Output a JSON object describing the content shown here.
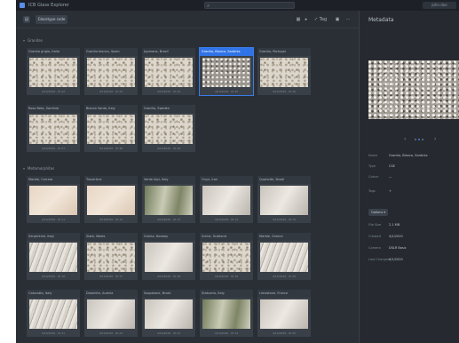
{
  "titlebar": {
    "app_title": "ICB Glass Explorer",
    "user": "john.doe"
  },
  "toolbar": {
    "pill": "Glasstype code",
    "grid_icon": "grid-icon",
    "arrow": "▸",
    "tag_label": "✓ Tag",
    "more": "⋯"
  },
  "sections": {
    "groups_title": "Granites",
    "minerals_title": "Metamorphites"
  },
  "groups_cards": [
    {
      "title": "Granito grigio, Italia",
      "foot": "4/10/2020 · ID 42"
    },
    {
      "title": "Granito bianco, Spain",
      "foot": "4/10/2020 · ID 43"
    },
    {
      "title": "Juparana, Brazil",
      "foot": "4/10/2020 · ID 44"
    },
    {
      "title": "Granito, Bianco, Sardinia",
      "foot": "4/10/2020 · ID 45"
    },
    {
      "title": "Granito, Portugal",
      "foot": "4/10/2020 · ID 46"
    },
    {
      "title": "Rosa Beta, Sardinia",
      "foot": "4/10/2020 · ID 47"
    },
    {
      "title": "Bianco Sardo, Italy",
      "foot": "4/10/2020 · ID 48"
    },
    {
      "title": "Granito, Sweden",
      "foot": "4/10/2020 · ID 49"
    }
  ],
  "minerals_cards": [
    {
      "title": "Marble, Carrara",
      "foot": "4/10/2020 · ID 11"
    },
    {
      "title": "Travertine",
      "foot": "4/10/2020 · ID 12"
    },
    {
      "title": "Verde Alpi, Italy",
      "foot": "4/10/2020 · ID 13"
    },
    {
      "title": "Onyx, Iran",
      "foot": "4/10/2020 · ID 14"
    },
    {
      "title": "Quartzite, Brazil",
      "foot": "4/10/2020 · ID 15"
    },
    {
      "title": "Serpentine, Italy",
      "foot": "4/10/2020 · ID 16"
    },
    {
      "title": "Slate, Wales",
      "foot": "4/10/2020 · ID 17"
    },
    {
      "title": "Gneiss, Norway",
      "foot": "4/10/2020 · ID 18"
    },
    {
      "title": "Schist, Scotland",
      "foot": "4/10/2020 · ID 19"
    },
    {
      "title": "Marble, Greece",
      "foot": "4/10/2020 · ID 20"
    },
    {
      "title": "Calacatta, Italy",
      "foot": "4/10/2020 · ID 21"
    },
    {
      "title": "Dolomite, Austria",
      "foot": "4/10/2020 · ID 22"
    },
    {
      "title": "Soapstone, Brazil",
      "foot": "4/10/2020 · ID 23"
    },
    {
      "title": "Statuario, Italy",
      "foot": "4/10/2020 · ID 24"
    },
    {
      "title": "Limestone, France",
      "foot": "4/10/2020 · ID 25"
    }
  ],
  "metadata": {
    "title": "Metadata",
    "pager_prev": "‹",
    "pager_next": "›",
    "rows": [
      {
        "label": "Name",
        "value": "Granito, Bianco, Sardinia"
      },
      {
        "label": "Type",
        "value": "CSE"
      },
      {
        "label": "Colour",
        "value": "—"
      }
    ],
    "tags_label": "Tags",
    "tags_add": "+",
    "options_button": "Options ▾",
    "details": [
      {
        "label": "File Size",
        "value": "2.1 MB"
      },
      {
        "label": "Created",
        "value": "4/1/2020"
      },
      {
        "label": "Camera",
        "value": "DSLR Basic"
      },
      {
        "label": "Last Changed",
        "value": "4/1/2020"
      }
    ]
  }
}
